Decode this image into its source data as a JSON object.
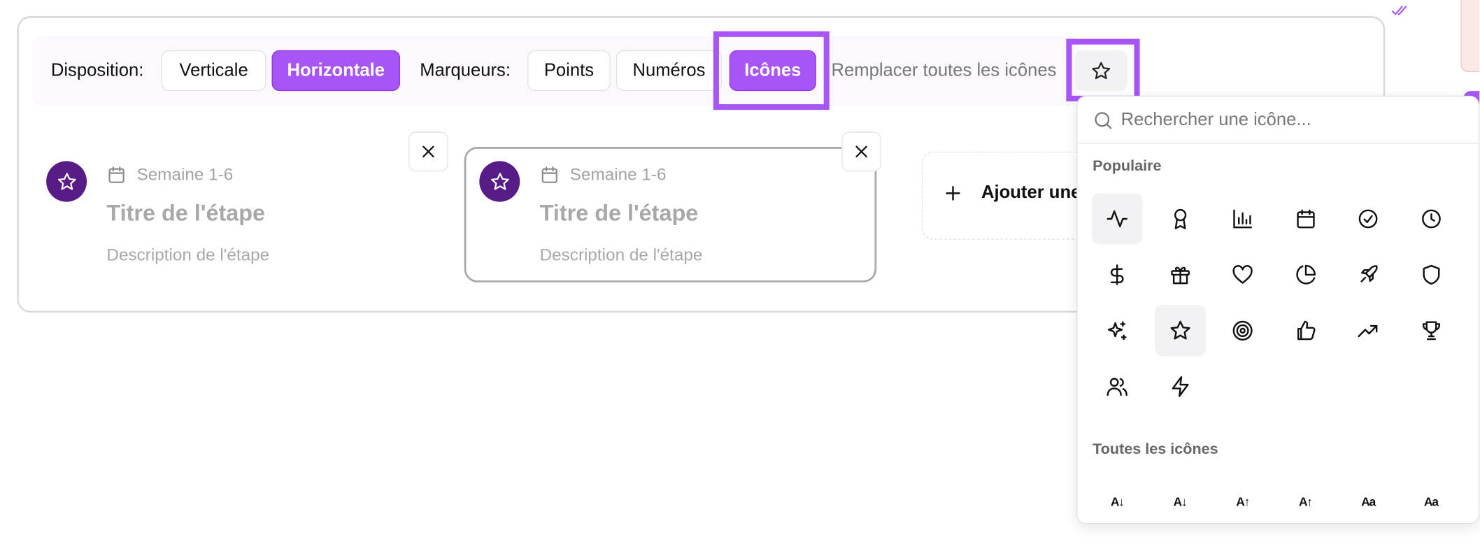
{
  "toolbar": {
    "disposition_label": "Disposition:",
    "disposition_options": [
      "Verticale",
      "Horizontale"
    ],
    "disposition_selected": "Horizontale",
    "marqueurs_label": "Marqueurs:",
    "marqueurs_options": [
      "Points",
      "Numéros",
      "Icônes"
    ],
    "marqueurs_selected": "Icônes",
    "replace_label": "Remplacer toutes les icônes",
    "current_icon": "star-icon"
  },
  "steps": [
    {
      "marker_icon": "star-icon",
      "week": "Semaine 1-6",
      "title": "Titre de l'étape",
      "description": "Description de l'étape"
    },
    {
      "marker_icon": "star-icon",
      "week": "Semaine 1-6",
      "title": "Titre de l'étape",
      "description": "Description de l'étape"
    }
  ],
  "add_step_label": "Ajouter une",
  "icon_picker": {
    "search_placeholder": "Rechercher une icône...",
    "popular_label": "Populaire",
    "popular_icons": [
      "activity-icon",
      "award-icon",
      "bar-chart-icon",
      "calendar-icon",
      "check-circle-icon",
      "clock-icon",
      "dollar-icon",
      "gift-icon",
      "heart-icon",
      "pie-chart-icon",
      "rocket-icon",
      "shield-icon",
      "sparkles-icon",
      "star-icon",
      "target-icon",
      "thumbs-up-icon",
      "trending-up-icon",
      "trophy-icon",
      "users-icon",
      "zap-icon"
    ],
    "selected_icon": "star-icon",
    "all_label": "Toutes les icônes",
    "all_icons_glyphs": [
      "A↓",
      "A↓",
      "A↑",
      "A↑",
      "Aa",
      "Aa"
    ]
  },
  "colors": {
    "accent": "#a855f7",
    "marker": "#581c87"
  }
}
